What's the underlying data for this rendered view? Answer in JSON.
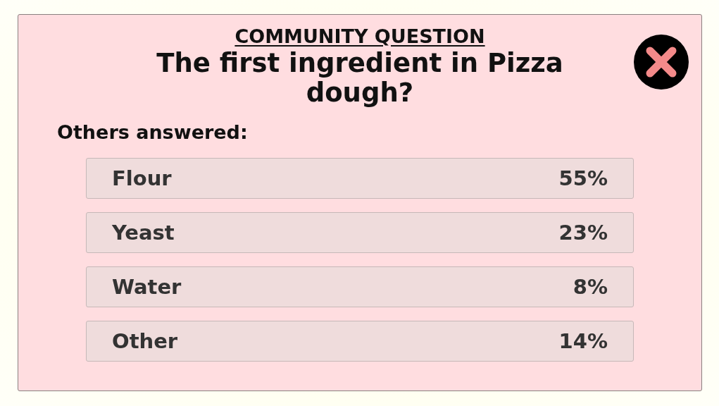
{
  "dialog": {
    "heading": "COMMUNITY QUESTION",
    "question": "The first ingredient in Pizza dough?",
    "answers_label": "Others answered:",
    "answers": [
      {
        "label": "Flour",
        "share": "55%"
      },
      {
        "label": "Yeast",
        "share": "23%"
      },
      {
        "label": "Water",
        "share": "8%"
      },
      {
        "label": "Other",
        "share": "14%"
      }
    ]
  }
}
